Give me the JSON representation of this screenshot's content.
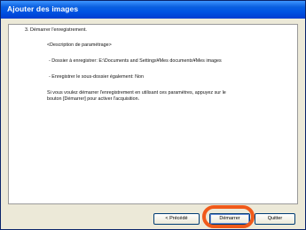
{
  "window": {
    "title": "Ajouter des images"
  },
  "content": {
    "step": "3. Démarrer l'enregistrement.",
    "description_header": "<Description de paramétrage>",
    "folder_line": "- Dossier à enregistrer:   E:\\Documents and Settings¥Mes documents¥Mes images",
    "subfolder_line": "- Enregistrer le sous-dossier  également:  Non",
    "info_line1": "Si vous voulez démarrer l'enregistrement en utilisant ces paramètres, appuyez sur le",
    "info_line2": "bouton [Démarrer] pour activer l'acquisition."
  },
  "buttons": {
    "previous": "< Précédé",
    "start": "Démarrer",
    "quit": "Quitter"
  },
  "colors": {
    "title_bar": "#0054e3",
    "highlight": "#f05a1a"
  }
}
